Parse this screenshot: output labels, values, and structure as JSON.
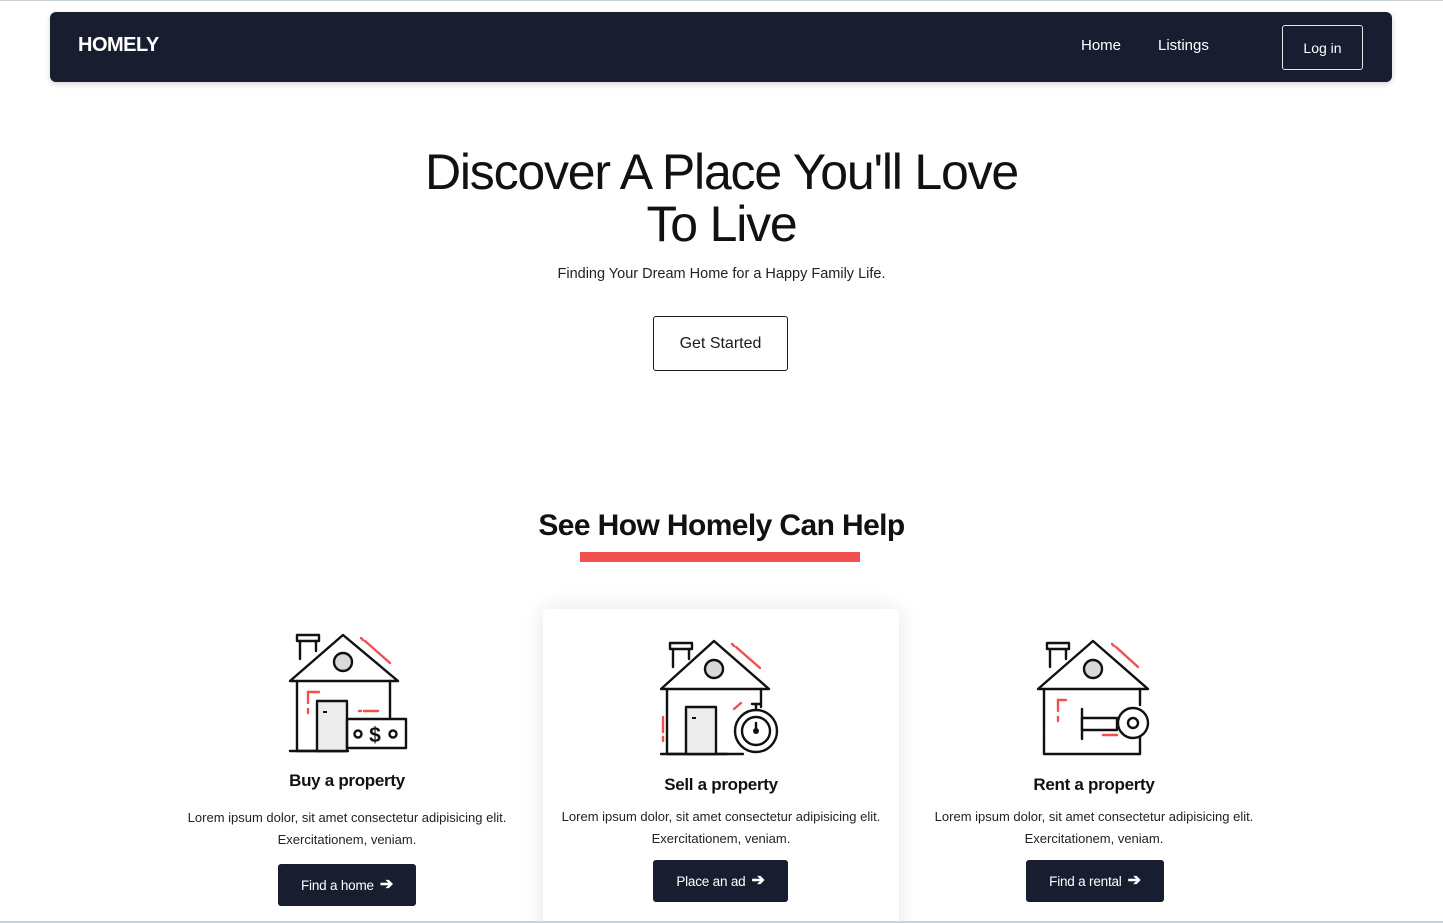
{
  "navbar": {
    "brand": "HOMELY",
    "links": [
      "Home",
      "Listings"
    ],
    "login_label": "Log in"
  },
  "hero": {
    "title_line1": "Discover A Place You'll Love",
    "title_line2": "To Live",
    "subtitle": "Finding Your Dream Home for a Happy Family Life.",
    "cta_label": "Get Started"
  },
  "help": {
    "title": "See How Homely Can Help",
    "accent_color": "#f24f4f",
    "cards": [
      {
        "icon": "house-money-icon",
        "title": "Buy a property",
        "description": "Lorem ipsum dolor, sit amet consectetur adipisicing elit. Exercitationem, veniam.",
        "button_label": "Find a home",
        "button_icon": "arrow-right-icon"
      },
      {
        "icon": "house-timer-icon",
        "title": "Sell a property",
        "description": "Lorem ipsum dolor, sit amet consectetur adipisicing elit. Exercitationem, veniam.",
        "button_label": "Place an ad",
        "button_icon": "arrow-right-icon"
      },
      {
        "icon": "house-key-icon",
        "title": "Rent a property",
        "description": "Lorem ipsum dolor, sit amet consectetur adipisicing elit. Exercitationem, veniam.",
        "button_label": "Find a rental",
        "button_icon": "arrow-right-icon"
      }
    ]
  },
  "colors": {
    "navbar_bg": "#181e2f",
    "button_bg": "#181e2f",
    "accent": "#f24f4f"
  }
}
